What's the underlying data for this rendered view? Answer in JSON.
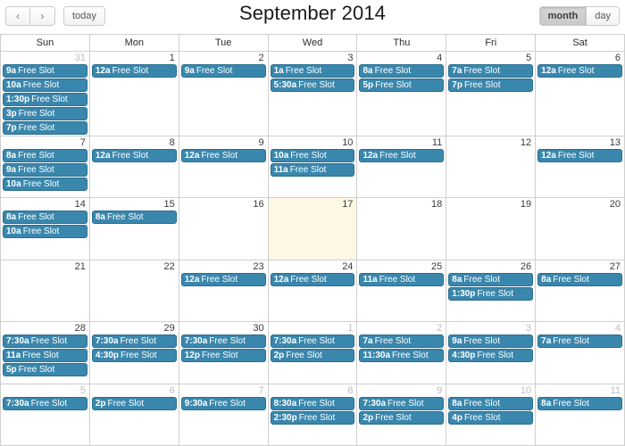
{
  "toolbar": {
    "prev_label": "‹",
    "next_label": "›",
    "today_label": "today",
    "title": "September 2014",
    "month_label": "month",
    "day_label": "day",
    "active_view": "month"
  },
  "weekdays": [
    "Sun",
    "Mon",
    "Tue",
    "Wed",
    "Thu",
    "Fri",
    "Sat"
  ],
  "colors": {
    "event_bg": "#3a87ad",
    "event_border": "#2b6d8e",
    "today_bg": "#fcf8e3",
    "grid_line": "#cfcfcf"
  },
  "weeks": [
    [
      {
        "num": "31",
        "other": true,
        "today": false,
        "events": [
          {
            "time": "9a",
            "title": "Free Slot"
          },
          {
            "time": "10a",
            "title": "Free Slot"
          },
          {
            "time": "1:30p",
            "title": "Free Slot"
          },
          {
            "time": "3p",
            "title": "Free Slot"
          },
          {
            "time": "7p",
            "title": "Free Slot"
          }
        ]
      },
      {
        "num": "1",
        "other": false,
        "today": false,
        "events": [
          {
            "time": "12a",
            "title": "Free Slot"
          }
        ]
      },
      {
        "num": "2",
        "other": false,
        "today": false,
        "events": [
          {
            "time": "9a",
            "title": "Free Slot"
          }
        ]
      },
      {
        "num": "3",
        "other": false,
        "today": false,
        "events": [
          {
            "time": "1a",
            "title": "Free Slot"
          },
          {
            "time": "5:30a",
            "title": "Free Slot"
          }
        ]
      },
      {
        "num": "4",
        "other": false,
        "today": false,
        "events": [
          {
            "time": "8a",
            "title": "Free Slot"
          },
          {
            "time": "5p",
            "title": "Free Slot"
          }
        ]
      },
      {
        "num": "5",
        "other": false,
        "today": false,
        "events": [
          {
            "time": "7a",
            "title": "Free Slot"
          },
          {
            "time": "7p",
            "title": "Free Slot"
          }
        ]
      },
      {
        "num": "6",
        "other": false,
        "today": false,
        "events": [
          {
            "time": "12a",
            "title": "Free Slot"
          }
        ]
      }
    ],
    [
      {
        "num": "7",
        "other": false,
        "today": false,
        "events": [
          {
            "time": "8a",
            "title": "Free Slot"
          },
          {
            "time": "9a",
            "title": "Free Slot"
          },
          {
            "time": "10a",
            "title": "Free Slot"
          }
        ]
      },
      {
        "num": "8",
        "other": false,
        "today": false,
        "events": [
          {
            "time": "12a",
            "title": "Free Slot"
          }
        ]
      },
      {
        "num": "9",
        "other": false,
        "today": false,
        "events": [
          {
            "time": "12a",
            "title": "Free Slot"
          }
        ]
      },
      {
        "num": "10",
        "other": false,
        "today": false,
        "events": [
          {
            "time": "10a",
            "title": "Free Slot"
          },
          {
            "time": "11a",
            "title": "Free Slot"
          }
        ]
      },
      {
        "num": "11",
        "other": false,
        "today": false,
        "events": [
          {
            "time": "12a",
            "title": "Free Slot"
          }
        ]
      },
      {
        "num": "12",
        "other": false,
        "today": false,
        "events": []
      },
      {
        "num": "13",
        "other": false,
        "today": false,
        "events": [
          {
            "time": "12a",
            "title": "Free Slot"
          }
        ]
      }
    ],
    [
      {
        "num": "14",
        "other": false,
        "today": false,
        "events": [
          {
            "time": "8a",
            "title": "Free Slot"
          },
          {
            "time": "10a",
            "title": "Free Slot"
          }
        ]
      },
      {
        "num": "15",
        "other": false,
        "today": false,
        "events": [
          {
            "time": "8a",
            "title": "Free Slot"
          }
        ]
      },
      {
        "num": "16",
        "other": false,
        "today": false,
        "events": []
      },
      {
        "num": "17",
        "other": false,
        "today": true,
        "events": []
      },
      {
        "num": "18",
        "other": false,
        "today": false,
        "events": []
      },
      {
        "num": "19",
        "other": false,
        "today": false,
        "events": []
      },
      {
        "num": "20",
        "other": false,
        "today": false,
        "events": []
      }
    ],
    [
      {
        "num": "21",
        "other": false,
        "today": false,
        "events": []
      },
      {
        "num": "22",
        "other": false,
        "today": false,
        "events": []
      },
      {
        "num": "23",
        "other": false,
        "today": false,
        "events": [
          {
            "time": "12a",
            "title": "Free Slot"
          }
        ]
      },
      {
        "num": "24",
        "other": false,
        "today": false,
        "events": [
          {
            "time": "12a",
            "title": "Free Slot"
          }
        ]
      },
      {
        "num": "25",
        "other": false,
        "today": false,
        "events": [
          {
            "time": "11a",
            "title": "Free Slot"
          }
        ]
      },
      {
        "num": "26",
        "other": false,
        "today": false,
        "events": [
          {
            "time": "8a",
            "title": "Free Slot"
          },
          {
            "time": "1:30p",
            "title": "Free Slot"
          }
        ]
      },
      {
        "num": "27",
        "other": false,
        "today": false,
        "events": [
          {
            "time": "8a",
            "title": "Free Slot"
          }
        ]
      }
    ],
    [
      {
        "num": "28",
        "other": false,
        "today": false,
        "events": [
          {
            "time": "7:30a",
            "title": "Free Slot"
          },
          {
            "time": "11a",
            "title": "Free Slot"
          },
          {
            "time": "5p",
            "title": "Free Slot"
          }
        ]
      },
      {
        "num": "29",
        "other": false,
        "today": false,
        "events": [
          {
            "time": "7:30a",
            "title": "Free Slot"
          },
          {
            "time": "4:30p",
            "title": "Free Slot"
          }
        ]
      },
      {
        "num": "30",
        "other": false,
        "today": false,
        "events": [
          {
            "time": "7:30a",
            "title": "Free Slot"
          },
          {
            "time": "12p",
            "title": "Free Slot"
          }
        ]
      },
      {
        "num": "1",
        "other": true,
        "today": false,
        "events": [
          {
            "time": "7:30a",
            "title": "Free Slot"
          },
          {
            "time": "2p",
            "title": "Free Slot"
          }
        ]
      },
      {
        "num": "2",
        "other": true,
        "today": false,
        "events": [
          {
            "time": "7a",
            "title": "Free Slot"
          },
          {
            "time": "11:30a",
            "title": "Free Slot"
          }
        ]
      },
      {
        "num": "3",
        "other": true,
        "today": false,
        "events": [
          {
            "time": "9a",
            "title": "Free Slot"
          },
          {
            "time": "4:30p",
            "title": "Free Slot"
          }
        ]
      },
      {
        "num": "4",
        "other": true,
        "today": false,
        "events": [
          {
            "time": "7a",
            "title": "Free Slot"
          }
        ]
      }
    ],
    [
      {
        "num": "5",
        "other": true,
        "today": false,
        "events": [
          {
            "time": "7:30a",
            "title": "Free Slot"
          }
        ]
      },
      {
        "num": "6",
        "other": true,
        "today": false,
        "events": [
          {
            "time": "2p",
            "title": "Free Slot"
          }
        ]
      },
      {
        "num": "7",
        "other": true,
        "today": false,
        "events": [
          {
            "time": "9:30a",
            "title": "Free Slot"
          }
        ]
      },
      {
        "num": "8",
        "other": true,
        "today": false,
        "events": [
          {
            "time": "8:30a",
            "title": "Free Slot"
          },
          {
            "time": "2:30p",
            "title": "Free Slot"
          }
        ]
      },
      {
        "num": "9",
        "other": true,
        "today": false,
        "events": [
          {
            "time": "7:30a",
            "title": "Free Slot"
          },
          {
            "time": "2p",
            "title": "Free Slot"
          }
        ]
      },
      {
        "num": "10",
        "other": true,
        "today": false,
        "events": [
          {
            "time": "8a",
            "title": "Free Slot"
          },
          {
            "time": "4p",
            "title": "Free Slot"
          }
        ]
      },
      {
        "num": "11",
        "other": true,
        "today": false,
        "events": [
          {
            "time": "8a",
            "title": "Free Slot"
          }
        ]
      }
    ]
  ]
}
